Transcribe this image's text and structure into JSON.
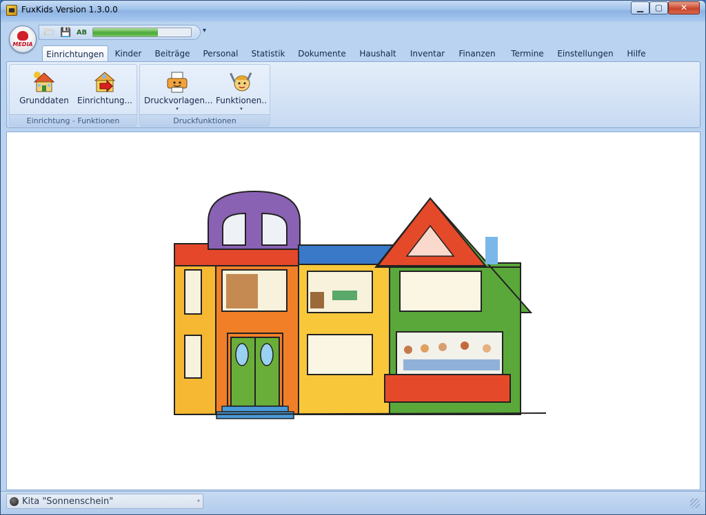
{
  "window": {
    "title": "FuxKids Version 1.3.0.0",
    "controls": {
      "minimize": "▁",
      "maximize": "▢",
      "close": "✕"
    }
  },
  "orb": {
    "label": "MEDIA"
  },
  "quick_access": {
    "icons": [
      "open-folder-icon",
      "save-icon",
      "spellcheck-icon"
    ],
    "spell_label": "AB",
    "progress": 0.66,
    "customize_glyph": "▾"
  },
  "tabs": [
    "Einrichtungen",
    "Kinder",
    "Beiträge",
    "Personal",
    "Statistik",
    "Dokumente",
    "Haushalt",
    "Inventar",
    "Finanzen",
    "Termine",
    "Einstellungen",
    "Hilfe"
  ],
  "active_tab": "Einrichtungen",
  "ribbon": {
    "groups": [
      {
        "label": "Einrichtung - Funktionen",
        "buttons": [
          {
            "label": "Grunddaten",
            "icon": "house-icon"
          },
          {
            "label": "Einrichtung...",
            "icon": "house-arrow-icon"
          }
        ]
      },
      {
        "label": "Druckfunktionen",
        "buttons": [
          {
            "label": "Druckvorlagen...",
            "icon": "printer-icon",
            "dropdown": "▾"
          },
          {
            "label": "Funktionen..",
            "icon": "tools-person-icon",
            "dropdown": "▾"
          }
        ]
      }
    ]
  },
  "content": {
    "illustration": "kindergarten-building-illustration"
  },
  "status": {
    "facility": "Kita \"Sonnenschein\"",
    "arrow": "▾"
  },
  "colors": {
    "accent": "#3a6fb8",
    "progress": "#4aa83a",
    "close": "#c9462a"
  }
}
